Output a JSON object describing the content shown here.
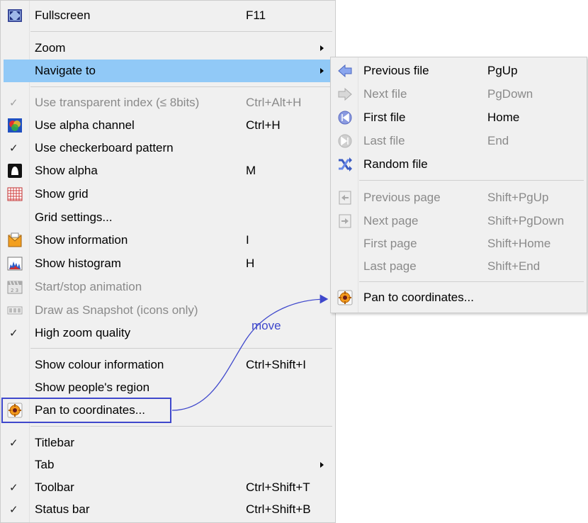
{
  "main_menu": {
    "items": [
      {
        "label": "Fullscreen",
        "shortcut": "F11",
        "icon": "fullscreen-icon"
      },
      {
        "label": "Zoom",
        "submenu": true
      },
      {
        "label": "Navigate to",
        "submenu": true,
        "highlighted": true
      },
      {
        "label": "Use transparent index (≤ 8bits)",
        "shortcut": "Ctrl+Alt+H",
        "checked": true,
        "disabled": true
      },
      {
        "label": "Use alpha channel",
        "shortcut": "Ctrl+H",
        "icon": "alpha-channel-icon"
      },
      {
        "label": "Use checkerboard pattern",
        "checked": true
      },
      {
        "label": "Show alpha",
        "shortcut": "M",
        "icon": "show-alpha-icon"
      },
      {
        "label": "Show grid",
        "icon": "grid-icon"
      },
      {
        "label": "Grid settings..."
      },
      {
        "label": "Show information",
        "shortcut": "I",
        "icon": "information-icon"
      },
      {
        "label": "Show histogram",
        "shortcut": "H",
        "icon": "histogram-icon"
      },
      {
        "label": "Start/stop animation",
        "disabled": true,
        "icon": "animation-icon"
      },
      {
        "label": "Draw as Snapshot (icons only)",
        "disabled": true,
        "icon": "snapshot-icon"
      },
      {
        "label": "High zoom quality",
        "checked": true
      },
      {
        "label": "Show colour information",
        "shortcut": "Ctrl+Shift+I"
      },
      {
        "label": "Show people's region"
      },
      {
        "label": "Pan to coordinates...",
        "icon": "pan-coordinates-icon"
      },
      {
        "label": "Titlebar",
        "checked": true
      },
      {
        "label": "Tab",
        "submenu": true
      },
      {
        "label": "Toolbar",
        "shortcut": "Ctrl+Shift+T",
        "checked": true
      },
      {
        "label": "Status bar",
        "shortcut": "Ctrl+Shift+B",
        "checked": true
      }
    ]
  },
  "sub_menu": {
    "items": [
      {
        "label": "Previous file",
        "shortcut": "PgUp",
        "icon": "arrow-left-icon"
      },
      {
        "label": "Next file",
        "shortcut": "PgDown",
        "disabled": true,
        "icon": "arrow-right-icon"
      },
      {
        "label": "First file",
        "shortcut": "Home",
        "icon": "first-file-icon"
      },
      {
        "label": "Last file",
        "shortcut": "End",
        "disabled": true,
        "icon": "last-file-icon"
      },
      {
        "label": "Random file",
        "icon": "random-icon"
      },
      {
        "label": "Previous page",
        "shortcut": "Shift+PgUp",
        "disabled": true,
        "icon": "previous-page-icon"
      },
      {
        "label": "Next page",
        "shortcut": "Shift+PgDown",
        "disabled": true,
        "icon": "next-page-icon"
      },
      {
        "label": "First page",
        "shortcut": "Shift+Home",
        "disabled": true
      },
      {
        "label": "Last page",
        "shortcut": "Shift+End",
        "disabled": true
      },
      {
        "label": "Pan to coordinates...",
        "icon": "pan-coordinates-icon"
      }
    ]
  },
  "annotation": {
    "label": "move",
    "color": "#3f48cc"
  },
  "colors": {
    "menu_bg": "#f0f0f0",
    "highlight": "#91c9f7",
    "disabled_text": "#8a8a8a"
  }
}
